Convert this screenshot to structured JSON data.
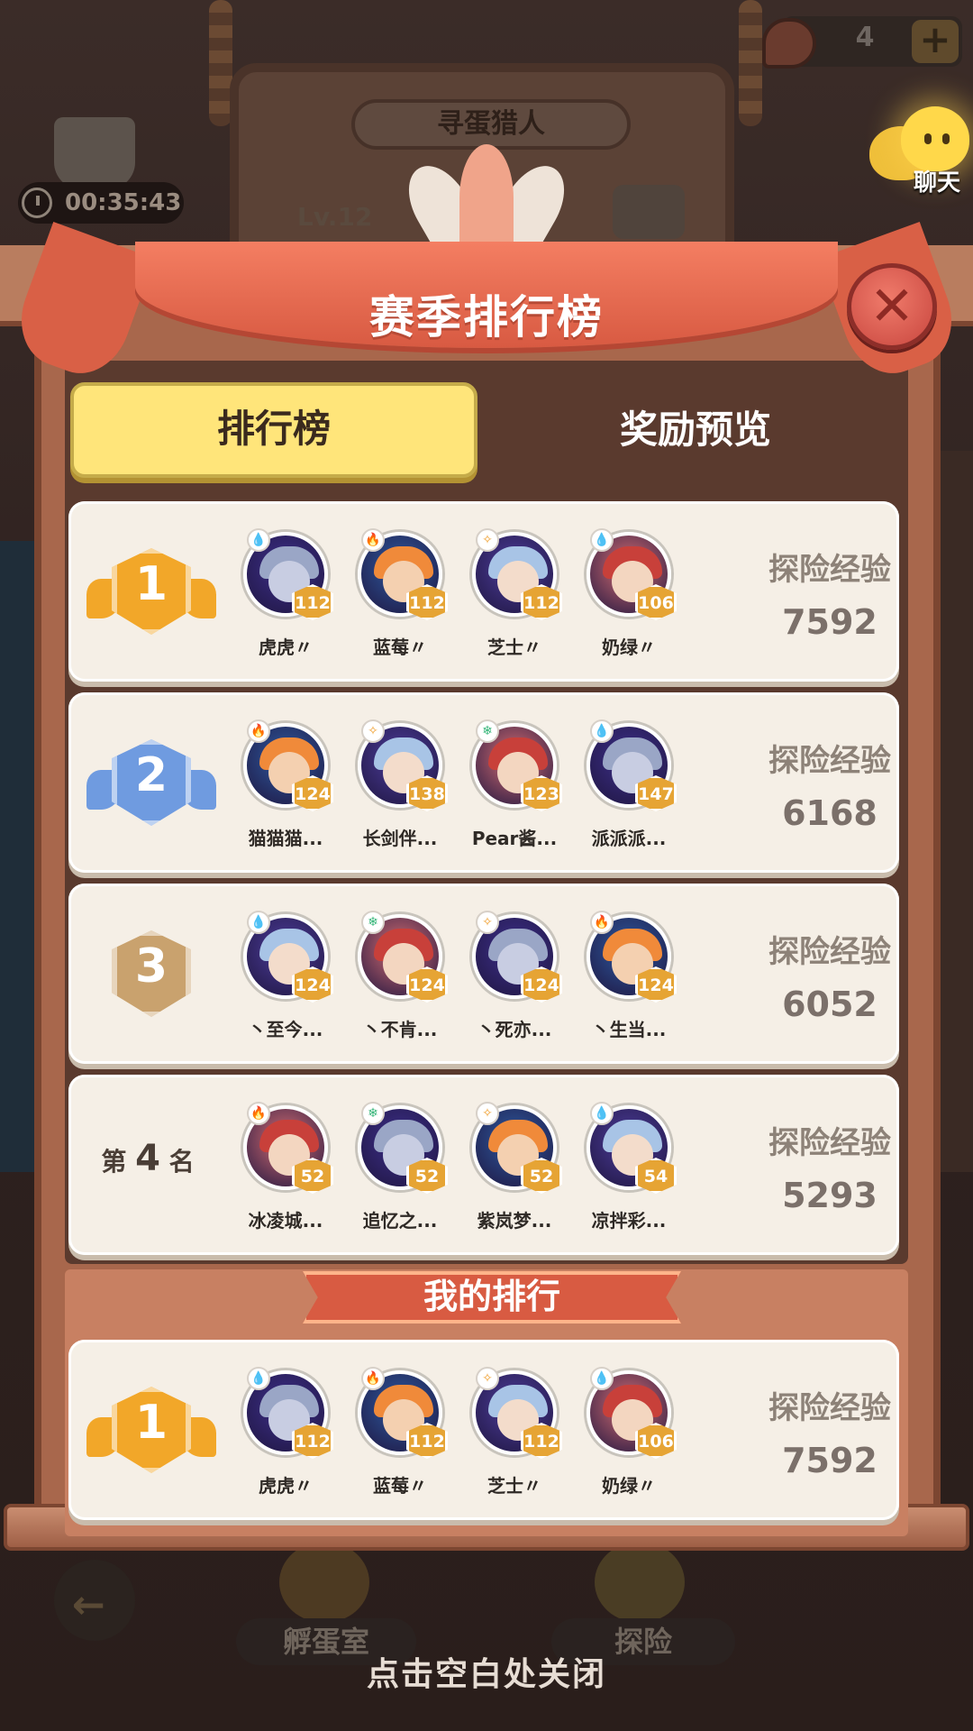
{
  "background": {
    "board_title": "寻蛋猎人",
    "level_text": "Lv.12",
    "timer": "00:35:43",
    "resource_count": "4",
    "chat_label": "聊天",
    "nav_left_label": "孵蛋室",
    "nav_right_label": "探险"
  },
  "modal": {
    "title": "赛季排行榜",
    "tabs": [
      {
        "label": "排行榜",
        "active": true
      },
      {
        "label": "奖励预览",
        "active": false
      }
    ],
    "exp_label": "探险经验",
    "rows": [
      {
        "rank": "1",
        "medal": "gold",
        "exp": "7592",
        "members": [
          {
            "name": "虎虎〃",
            "level": "112",
            "element": "water"
          },
          {
            "name": "蓝莓〃",
            "level": "112",
            "element": "fire"
          },
          {
            "name": "芝士〃",
            "level": "112",
            "element": "light"
          },
          {
            "name": "奶绿〃",
            "level": "106",
            "element": "water"
          }
        ]
      },
      {
        "rank": "2",
        "medal": "silver",
        "exp": "6168",
        "members": [
          {
            "name": "猫猫猫...",
            "level": "124",
            "element": "fire"
          },
          {
            "name": "长剑伴...",
            "level": "138",
            "element": "light"
          },
          {
            "name": "Pear酱...",
            "level": "123",
            "element": "wind"
          },
          {
            "name": "派派派...",
            "level": "147",
            "element": "water"
          }
        ]
      },
      {
        "rank": "3",
        "medal": "bronze",
        "exp": "6052",
        "members": [
          {
            "name": "丶至今...",
            "level": "124",
            "element": "water"
          },
          {
            "name": "丶不肯...",
            "level": "124",
            "element": "wind"
          },
          {
            "name": "丶死亦...",
            "level": "124",
            "element": "light"
          },
          {
            "name": "丶生当...",
            "level": "124",
            "element": "fire"
          }
        ]
      },
      {
        "rank_prefix": "第",
        "rank": "4",
        "rank_suffix": "名",
        "medal": "none",
        "exp": "5293",
        "members": [
          {
            "name": "冰凌城...",
            "level": "52",
            "element": "fire"
          },
          {
            "name": "追忆之...",
            "level": "52",
            "element": "wind"
          },
          {
            "name": "紫岚梦...",
            "level": "52",
            "element": "light"
          },
          {
            "name": "凉拌彩...",
            "level": "54",
            "element": "water"
          }
        ]
      }
    ],
    "my_rank_title": "我的排行",
    "my_row": {
      "rank": "1",
      "medal": "gold",
      "exp": "7592",
      "members": [
        {
          "name": "虎虎〃",
          "level": "112",
          "element": "water"
        },
        {
          "name": "蓝莓〃",
          "level": "112",
          "element": "fire"
        },
        {
          "name": "芝士〃",
          "level": "112",
          "element": "light"
        },
        {
          "name": "奶绿〃",
          "level": "106",
          "element": "water"
        }
      ]
    },
    "close_hint": "点击空白处关闭",
    "colors": {
      "gold_medal": "#f2a729",
      "silver_medal": "#6f9be0",
      "bronze_medal": "#c9a26e",
      "tab_active": "#ffe57a",
      "ribbon": "#e8694f"
    }
  }
}
